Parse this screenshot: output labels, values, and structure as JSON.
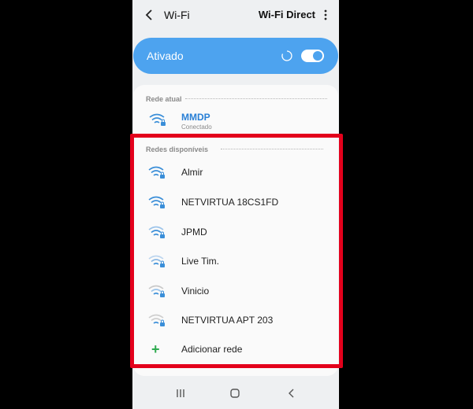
{
  "header": {
    "title": "Wi-Fi",
    "wifi_direct_label": "Wi-Fi Direct",
    "back_icon": "chevron-left-icon",
    "more_icon": "more-vertical-icon"
  },
  "status_bar": {
    "label": "Ativado",
    "toggle_on": true,
    "scanning": true
  },
  "current_network": {
    "section_title": "Rede atual",
    "name": "MMDP",
    "status": "Conectado"
  },
  "available_networks": {
    "section_title": "Redes disponíveis",
    "items": [
      {
        "name": "Almir"
      },
      {
        "name": "NETVIRTUA 18CS1FD"
      },
      {
        "name": "JPMD"
      },
      {
        "name": "Live Tim."
      },
      {
        "name": "Vinicio"
      },
      {
        "name": "NETVIRTUA APT 203"
      }
    ],
    "add_label": "Adicionar rede"
  },
  "colors": {
    "accent": "#4da3ef",
    "link": "#2a80d6",
    "highlight": "#e3001b",
    "add": "#2eaa4f"
  }
}
